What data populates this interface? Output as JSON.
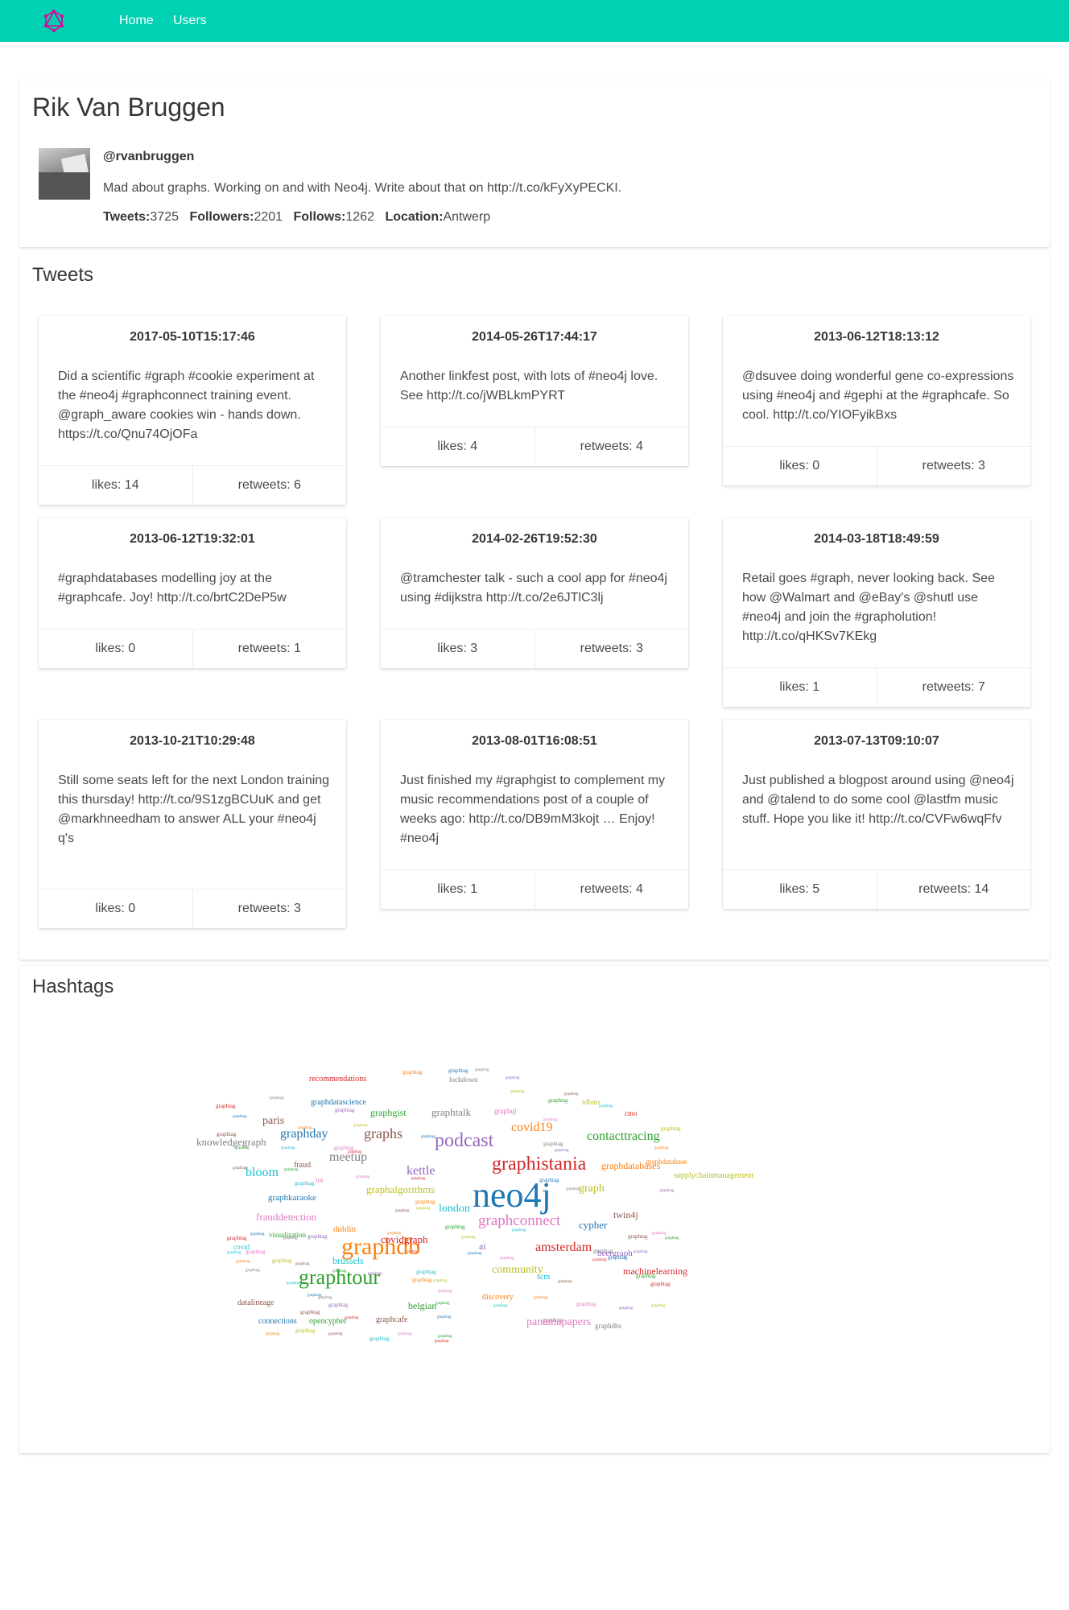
{
  "nav": {
    "links": [
      "Home",
      "Users"
    ],
    "accent": "#00d1b2"
  },
  "profile": {
    "name": "Rik Van Bruggen",
    "handle": "@rvanbruggen",
    "bio": "Mad about graphs. Working on and with Neo4j. Write about that on http://t.co/kFyXyPECKI.",
    "stats": [
      {
        "label": "Tweets:",
        "value": "3725"
      },
      {
        "label": "Followers:",
        "value": "2201"
      },
      {
        "label": "Follows:",
        "value": "1262"
      },
      {
        "label": "Location:",
        "value": "Antwerp"
      }
    ]
  },
  "tweets_section": {
    "title": "Tweets",
    "tweets": [
      {
        "date": "2017-05-10T15:17:46",
        "text": "Did a scientific #graph #cookie experiment at the #neo4j #graphconnect training event. @graph_aware cookies win - hands down. https://t.co/Qnu74OjOFa",
        "likes": "likes: 14",
        "retweets": "retweets: 6"
      },
      {
        "date": "2014-05-26T17:44:17",
        "text": "Another linkfest post, with lots of #neo4j love. See http://t.co/jWBLkmPYRT",
        "likes": "likes: 4",
        "retweets": "retweets: 4"
      },
      {
        "date": "2013-06-12T18:13:12",
        "text": "@dsuvee doing wonderful gene co-expressions using #neo4j and #gephi at the #graphcafe. So cool. http://t.co/YIOFyikBxs",
        "likes": "likes: 0",
        "retweets": "retweets: 3"
      },
      {
        "date": "2013-06-12T19:32:01",
        "text": "#graphdatabases modelling joy at the #graphcafe. Joy! http://t.co/brtC2DeP5w",
        "likes": "likes: 0",
        "retweets": "retweets: 1"
      },
      {
        "date": "2014-02-26T19:52:30",
        "text": "@tramchester talk - such a cool app for #neo4j using #dijkstra http://t.co/2e6JTlC3lj",
        "likes": "likes: 3",
        "retweets": "retweets: 3"
      },
      {
        "date": "2014-03-18T18:49:59",
        "text": "Retail goes #graph, never looking back. See how @Walmart and @eBay's @shutl use #neo4j and join the #grapholution! http://t.co/qHKSv7KEkg",
        "likes": "likes: 1",
        "retweets": "retweets: 7"
      },
      {
        "date": "2013-10-21T10:29:48",
        "text": "Still some seats left for the next London training this thursday! http://t.co/9S1zgBCUuK and get @markhneedham to answer ALL your #neo4j q's",
        "likes": "likes: 0",
        "retweets": "retweets: 3"
      },
      {
        "date": "2013-08-01T16:08:51",
        "text": "Just finished my #graphgist to complement my music recommendations post of a couple of weeks ago: http://t.co/DB9mM3kojt … Enjoy! #neo4j",
        "likes": "likes: 1",
        "retweets": "retweets: 4"
      },
      {
        "date": "2013-07-13T09:10:07",
        "text": "Just published a blogpost around using @neo4j and @talend to do some cool @lastfm music stuff. Hope you like it! http://t.co/CVFw6wqFfv",
        "likes": "likes: 5",
        "retweets": "retweets: 14"
      }
    ]
  },
  "hashtags_section": {
    "title": "Hashtags",
    "words": [
      {
        "text": "neo4j",
        "color": "#1f77b4"
      },
      {
        "text": "graphdb",
        "color": "#ff7f0e"
      },
      {
        "text": "graphtour",
        "color": "#2ca02c"
      },
      {
        "text": "graphistania",
        "color": "#d62728"
      },
      {
        "text": "podcast",
        "color": "#9467bd"
      },
      {
        "text": "graphconnect",
        "color": "#e377c2"
      },
      {
        "text": "graphs",
        "color": "#8c564b"
      },
      {
        "text": "meetup",
        "color": "#7f7f7f"
      },
      {
        "text": "contacttracing",
        "color": "#2ca02c"
      },
      {
        "text": "covid19",
        "color": "#ff7f0e"
      },
      {
        "text": "graphday",
        "color": "#1f77b4"
      },
      {
        "text": "bloom",
        "color": "#17becf"
      },
      {
        "text": "kettle",
        "color": "#9467bd"
      },
      {
        "text": "amsterdam",
        "color": "#d62728"
      },
      {
        "text": "graph",
        "color": "#bcbd22"
      },
      {
        "text": "community",
        "color": "#bcbd22"
      },
      {
        "text": "panamapapers",
        "color": "#e377c2"
      },
      {
        "text": "paris",
        "color": "#8c564b"
      },
      {
        "text": "london",
        "color": "#17becf"
      },
      {
        "text": "cypher",
        "color": "#1f77b4"
      },
      {
        "text": "graphtalk",
        "color": "#7f7f7f"
      },
      {
        "text": "knowledgegraph",
        "color": "#7f7f7f"
      },
      {
        "text": "frauddetection",
        "color": "#e377c2"
      },
      {
        "text": "covidgraph",
        "color": "#d62728"
      },
      {
        "text": "graphalgorithms",
        "color": "#bcbd22"
      },
      {
        "text": "graphdatabases",
        "color": "#ff7f0e"
      },
      {
        "text": "brussels",
        "color": "#17becf"
      },
      {
        "text": "twin4j",
        "color": "#8c564b"
      },
      {
        "text": "graphgist",
        "color": "#2ca02c"
      },
      {
        "text": "machinelearning",
        "color": "#d62728"
      },
      {
        "text": "ai",
        "color": "#9467bd"
      },
      {
        "text": "dublin",
        "color": "#ff7f0e"
      },
      {
        "text": "graphkaraoke",
        "color": "#1f77b4"
      },
      {
        "text": "belgian",
        "color": "#2ca02c"
      },
      {
        "text": "beergraph",
        "color": "#9467bd"
      },
      {
        "text": "supplychainmanagement",
        "color": "#bcbd22"
      },
      {
        "text": "recommendations",
        "color": "#d62728"
      },
      {
        "text": "graphdatascience",
        "color": "#1f77b4"
      },
      {
        "text": "datalineage",
        "color": "#8c564b"
      },
      {
        "text": "connections",
        "color": "#1f77b4"
      },
      {
        "text": "opencypher",
        "color": "#2ca02c"
      },
      {
        "text": "graphcafe",
        "color": "#8c564b"
      },
      {
        "text": "graphdbs",
        "color": "#7f7f7f"
      },
      {
        "text": "discovery",
        "color": "#ff7f0e"
      },
      {
        "text": "visualization",
        "color": "#2ca02c"
      },
      {
        "text": "fraud",
        "color": "#8c564b"
      },
      {
        "text": "rdbms",
        "color": "#bcbd22"
      },
      {
        "text": "cmo",
        "color": "#d62728"
      },
      {
        "text": "iot",
        "color": "#e377c2"
      },
      {
        "text": "scm",
        "color": "#17becf"
      },
      {
        "text": "covid",
        "color": "#17becf"
      },
      {
        "text": "graphdatabase",
        "color": "#ff7f0e"
      },
      {
        "text": "graphql",
        "color": "#e377c2"
      },
      {
        "text": "lockdown",
        "color": "#7f7f7f"
      }
    ]
  }
}
